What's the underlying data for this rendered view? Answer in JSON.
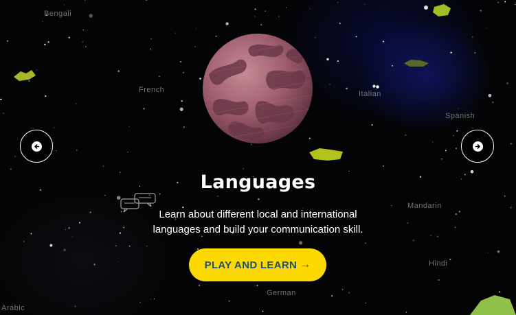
{
  "slide": {
    "title": "Languages",
    "description_lines": [
      "Learn about different local and international",
      "languages and build your communication skill."
    ],
    "cta_label": "PLAY AND LEARN",
    "cta_arrow": "→"
  },
  "navigation": {
    "prev_icon": "arrow-left-circle-icon",
    "next_icon": "arrow-right-circle-icon"
  },
  "background_labels": [
    "Bengali",
    "French",
    "Italian",
    "Spanish",
    "Mandarin",
    "Hindi",
    "German",
    "Arabic"
  ],
  "colors": {
    "cta_background": "#fcd900",
    "cta_text": "#1f4f7a",
    "planet": "#9b5a6a",
    "background": "#040406"
  }
}
